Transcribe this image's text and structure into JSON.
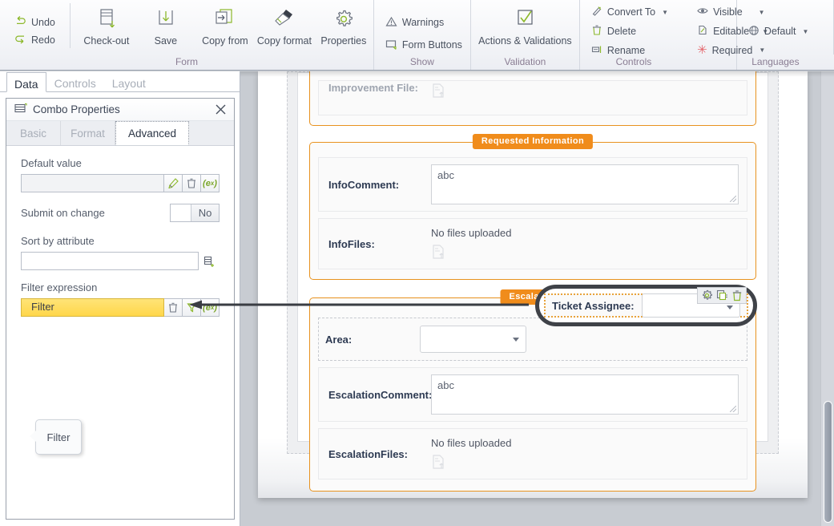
{
  "ribbon": {
    "groups": [
      {
        "label": "Form",
        "quick": [
          {
            "label": "Undo",
            "icon": "undo-icon"
          },
          {
            "label": "Redo",
            "icon": "redo-icon"
          }
        ],
        "buttons": [
          {
            "label": "Check-out",
            "icon": "check-out-icon"
          },
          {
            "label": "Save",
            "icon": "save-icon"
          },
          {
            "label": "Copy from",
            "icon": "copy-from-icon"
          },
          {
            "label": "Copy format",
            "icon": "copy-format-icon"
          },
          {
            "label": "Properties",
            "icon": "gear-icon"
          }
        ]
      },
      {
        "label": "Show",
        "items": [
          {
            "label": "Warnings",
            "icon": "warning-triangle-icon"
          },
          {
            "label": "Form Buttons",
            "icon": "form-buttons-icon"
          }
        ]
      },
      {
        "label": "Validation",
        "buttons": [
          {
            "label": "Actions & Validations",
            "icon": "checkmark-box-icon"
          }
        ]
      },
      {
        "label": "Controls",
        "items": [
          {
            "label": "Convert To",
            "icon": "convert-to-icon",
            "dropdown": true
          },
          {
            "label": "Delete",
            "icon": "trash-icon",
            "dropdown": false
          },
          {
            "label": "Rename",
            "icon": "rename-icon",
            "dropdown": false
          },
          {
            "label": "Visible",
            "icon": "eye-icon",
            "dropdown": true
          },
          {
            "label": "Editable",
            "icon": "editable-icon",
            "dropdown": true
          },
          {
            "label": "Required",
            "icon": "asterisk-icon",
            "dropdown": true
          }
        ]
      },
      {
        "label": "Languages",
        "items": [
          {
            "label": "Default",
            "icon": "globe-icon",
            "dropdown": true
          }
        ]
      }
    ]
  },
  "left_panel": {
    "tabs": [
      {
        "label": "Data",
        "selected": true
      },
      {
        "label": "Controls",
        "selected": false
      },
      {
        "label": "Layout",
        "selected": false
      }
    ],
    "properties": {
      "title": "Combo Properties",
      "icon": "combo-properties-icon",
      "close_label": "✕",
      "tabs": [
        {
          "label": "Basic",
          "selected": false
        },
        {
          "label": "Format",
          "selected": false
        },
        {
          "label": "Advanced",
          "selected": true
        }
      ],
      "fields": {
        "default_value": {
          "label": "Default value",
          "value": "",
          "buttons": [
            {
              "name": "edit-pencil",
              "label": "✎"
            },
            {
              "name": "delete-trash",
              "label": "Ὕ1"
            },
            {
              "name": "expression",
              "label": "(ex)"
            }
          ]
        },
        "submit_on_change": {
          "label": "Submit on change",
          "value": "No"
        },
        "sort_by_attribute": {
          "label": "Sort by attribute",
          "value": ""
        },
        "filter_expression": {
          "label": "Filter expression",
          "value": "Filter",
          "highlight_color": "#ffd64a"
        }
      },
      "tooltip": "Filter"
    }
  },
  "form": {
    "top_partial_section": {
      "rows": [
        {
          "label": "Improvement File:",
          "value": "",
          "type": "file"
        }
      ]
    },
    "sections": [
      {
        "title": "Requested Information",
        "rows": [
          {
            "label": "InfoComment:",
            "value": "abc",
            "type": "textarea"
          },
          {
            "label": "InfoFiles:",
            "value": "No files uploaded",
            "type": "file"
          }
        ]
      },
      {
        "title": "Escalation",
        "inline_row": {
          "left": {
            "label": "Area:",
            "value": "",
            "type": "combo"
          },
          "right": {
            "label": "Ticket Assignee:",
            "value": "",
            "type": "combo",
            "selected": true
          }
        },
        "rows": [
          {
            "label": "EscalationComment:",
            "value": "abc",
            "type": "textarea"
          },
          {
            "label": "EscalationFiles:",
            "value": "No files uploaded",
            "type": "file"
          }
        ]
      }
    ],
    "selected_control_actions": [
      {
        "name": "gear-icon",
        "label": "settings"
      },
      {
        "name": "duplicate-icon",
        "label": "duplicate"
      },
      {
        "name": "trash-icon",
        "label": "delete"
      }
    ]
  },
  "colors": {
    "accent_orange": "#f08c1b",
    "highlight_yellow": "#ffd64a",
    "selection_dark": "#3f4248",
    "green": "#8cb82b"
  }
}
